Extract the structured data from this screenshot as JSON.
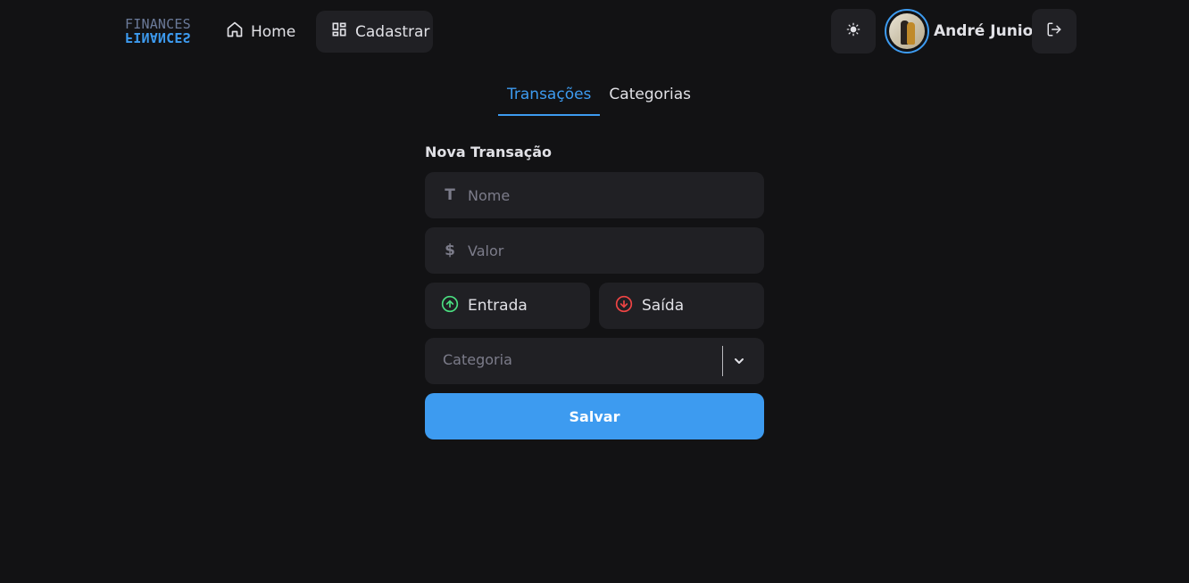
{
  "header": {
    "logo_text": "FINANCES",
    "nav": [
      {
        "label": "Home",
        "icon": "home-icon"
      },
      {
        "label": "Cadastrar",
        "icon": "dashboard-icon"
      }
    ],
    "theme_toggle_icon": "sun-icon",
    "user": {
      "name": "André Junior"
    },
    "logout_icon": "logout-icon"
  },
  "tabs": [
    {
      "label": "Transações",
      "active": true
    },
    {
      "label": "Categorias",
      "active": false
    }
  ],
  "form": {
    "title": "Nova Transação",
    "name_field": {
      "placeholder": "Nome",
      "icon_glyph": "T"
    },
    "value_field": {
      "placeholder": "Valor",
      "icon_glyph": "$"
    },
    "type_in": {
      "label": "Entrada",
      "color": "#4ade80"
    },
    "type_out": {
      "label": "Saída",
      "color": "#ef4444"
    },
    "category": {
      "placeholder": "Categoria"
    },
    "save_label": "Salvar"
  },
  "colors": {
    "accent": "#3d9bf0",
    "background": "#121214",
    "surface": "#202024"
  }
}
